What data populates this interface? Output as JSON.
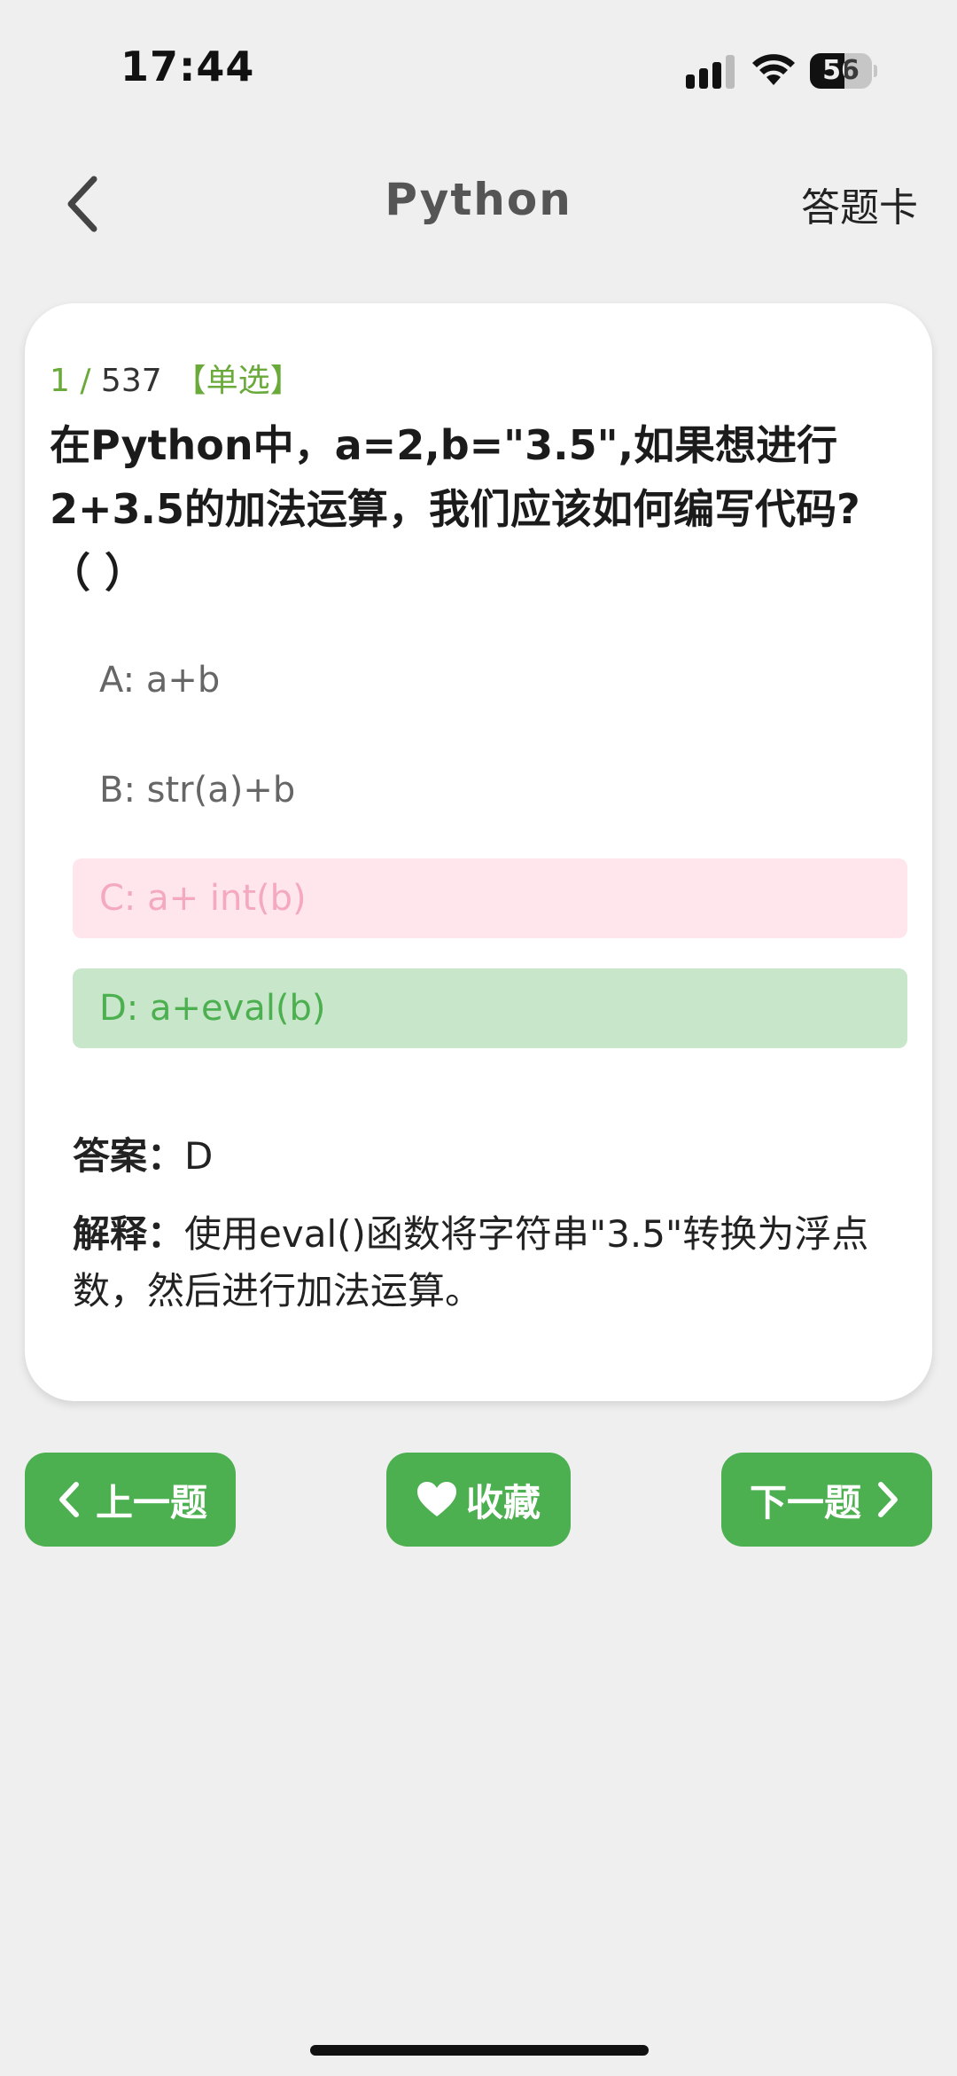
{
  "status_bar": {
    "time": "17:44",
    "battery": "56",
    "battery_level_percent": 56
  },
  "nav": {
    "title": "Python",
    "answer_card": "答题卡"
  },
  "question": {
    "current": "1",
    "separator": " / ",
    "total": "537",
    "type": "【单选】",
    "text": "在Python中，a=2,b=\"3.5\",如果想进行2+3.5的加法运算，我们应该如何编写代码?（ ）",
    "options": [
      {
        "label": "A: a+b",
        "state": "normal"
      },
      {
        "label": "B: str(a)+b",
        "state": "normal"
      },
      {
        "label": "C: a+ int(b)",
        "state": "wrong"
      },
      {
        "label": "D: a+eval(b)",
        "state": "correct"
      }
    ],
    "answer_label": "答案：",
    "answer_value": "D",
    "explanation_label": "解释：",
    "explanation_text": "使用eval()函数将字符串\"3.5\"转换为浮点数，然后进行加法运算。"
  },
  "buttons": {
    "prev": "上一题",
    "favorite": "收藏",
    "next": "下一题"
  },
  "colors": {
    "accent": "#4caf50",
    "wrong_bg": "#ffe6ec",
    "wrong_text": "#f4a9c1",
    "correct_bg": "#c8e6c9",
    "page_bg": "#efefef"
  },
  "icons": {
    "back": "chevron-left-icon",
    "favorite": "heart-icon",
    "prev": "chevron-left-icon",
    "next": "chevron-right-icon"
  }
}
